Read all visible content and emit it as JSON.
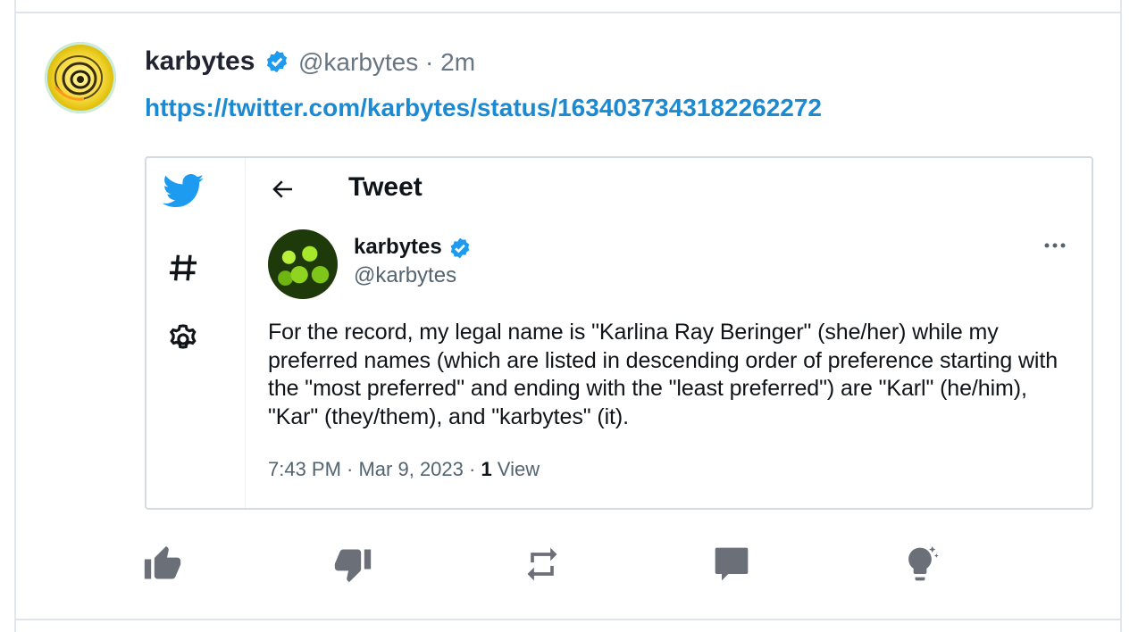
{
  "post": {
    "author_name": "karbytes",
    "author_handle": "@karbytes · 2m",
    "link": "https://twitter.com/karbytes/status/1634037343182262272"
  },
  "embed": {
    "title": "Tweet",
    "author_name": "karbytes",
    "author_handle": "@karbytes",
    "text": "For the record, my legal name is \"Karlina Ray Beringer\" (she/her) while my preferred names (which are listed in descending order of preference starting with the \"most preferred\" and ending with the \"least preferred\") are \"Karl\" (he/him), \"Kar\" (they/them), and \"karbytes\" (it).",
    "time_date": "7:43 PM · Mar 9, 2023 · ",
    "view_count": "1",
    "view_label": " View"
  },
  "colors": {
    "link": "#1b8ad3",
    "verified": "#1d9bf0",
    "icon_gray": "#6b6f78"
  },
  "actions": [
    {
      "name": "like",
      "icon": "thumb-up-icon"
    },
    {
      "name": "dislike",
      "icon": "thumb-down-icon"
    },
    {
      "name": "repost",
      "icon": "repost-icon"
    },
    {
      "name": "comment",
      "icon": "comment-icon"
    },
    {
      "name": "insight",
      "icon": "lightbulb-icon"
    }
  ]
}
